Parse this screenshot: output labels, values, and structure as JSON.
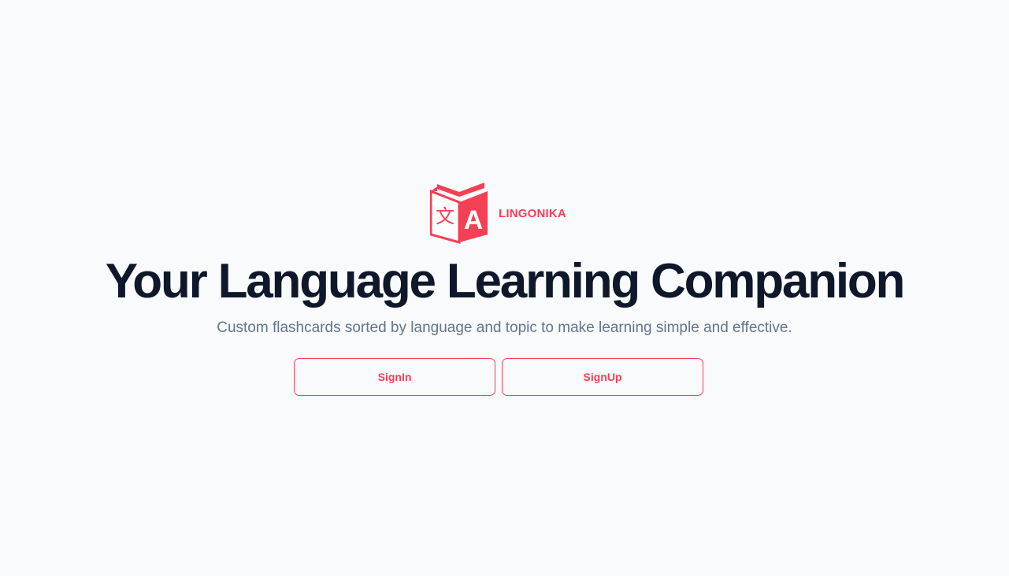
{
  "brand": {
    "name": "LINGONIKA",
    "logo_glyph": "文",
    "logo_letter": "A",
    "accent_color": "#f43f54"
  },
  "hero": {
    "title": "Your Language Learning Companion",
    "subtitle": "Custom flashcards sorted by language and topic to make learning simple and effective."
  },
  "actions": {
    "signin_label": "SignIn",
    "signup_label": "SignUp"
  }
}
